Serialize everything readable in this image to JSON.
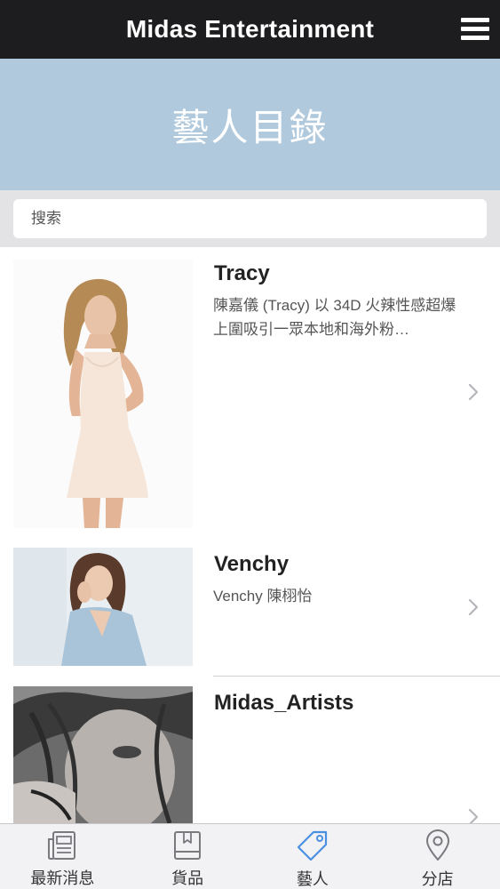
{
  "navbar": {
    "title": "Midas Entertainment"
  },
  "banner": {
    "heading": "藝人目錄"
  },
  "search": {
    "placeholder": "搜索"
  },
  "artists": [
    {
      "name": "Tracy",
      "description": "陳嘉儀 (Tracy) 以 34D 火辣性感超爆上圍吸引一眾本地和海外粉…"
    },
    {
      "name": "Venchy",
      "description": "Venchy 陳栩怡"
    },
    {
      "name": "Midas_Artists",
      "description": ""
    }
  ],
  "tabs": [
    {
      "label": "最新消息",
      "icon": "news-icon",
      "active": false
    },
    {
      "label": "貨品",
      "icon": "book-icon",
      "active": false
    },
    {
      "label": "藝人",
      "icon": "tag-icon",
      "active": true
    },
    {
      "label": "分店",
      "icon": "location-pin-icon",
      "active": false
    }
  ],
  "colors": {
    "navbar": "#1d1d1f",
    "banner": "#b0c9dc",
    "active_tab": "#4a90e2",
    "inactive_tab": "#7a7a7e"
  }
}
